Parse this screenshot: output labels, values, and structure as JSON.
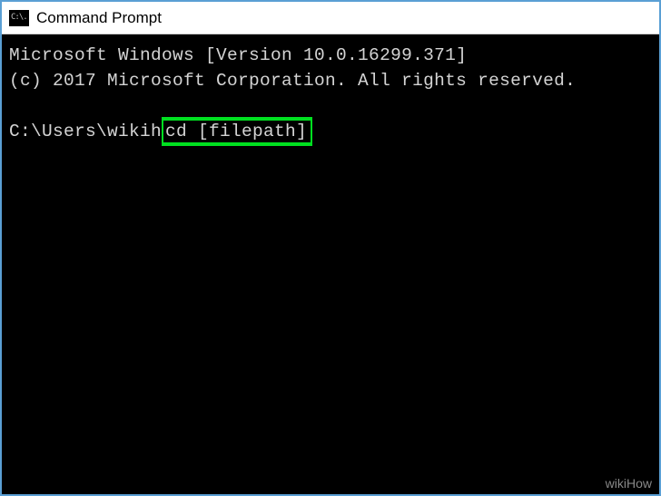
{
  "window": {
    "title": "Command Prompt",
    "icon_text": "C:\\."
  },
  "terminal": {
    "version_line": "Microsoft Windows [Version 10.0.16299.371]",
    "copyright_line": "(c) 2017 Microsoft Corporation. All rights reserved.",
    "prompt_path": "C:\\Users\\wikih",
    "command": "cd [filepath]"
  },
  "watermark": "wikiHow"
}
